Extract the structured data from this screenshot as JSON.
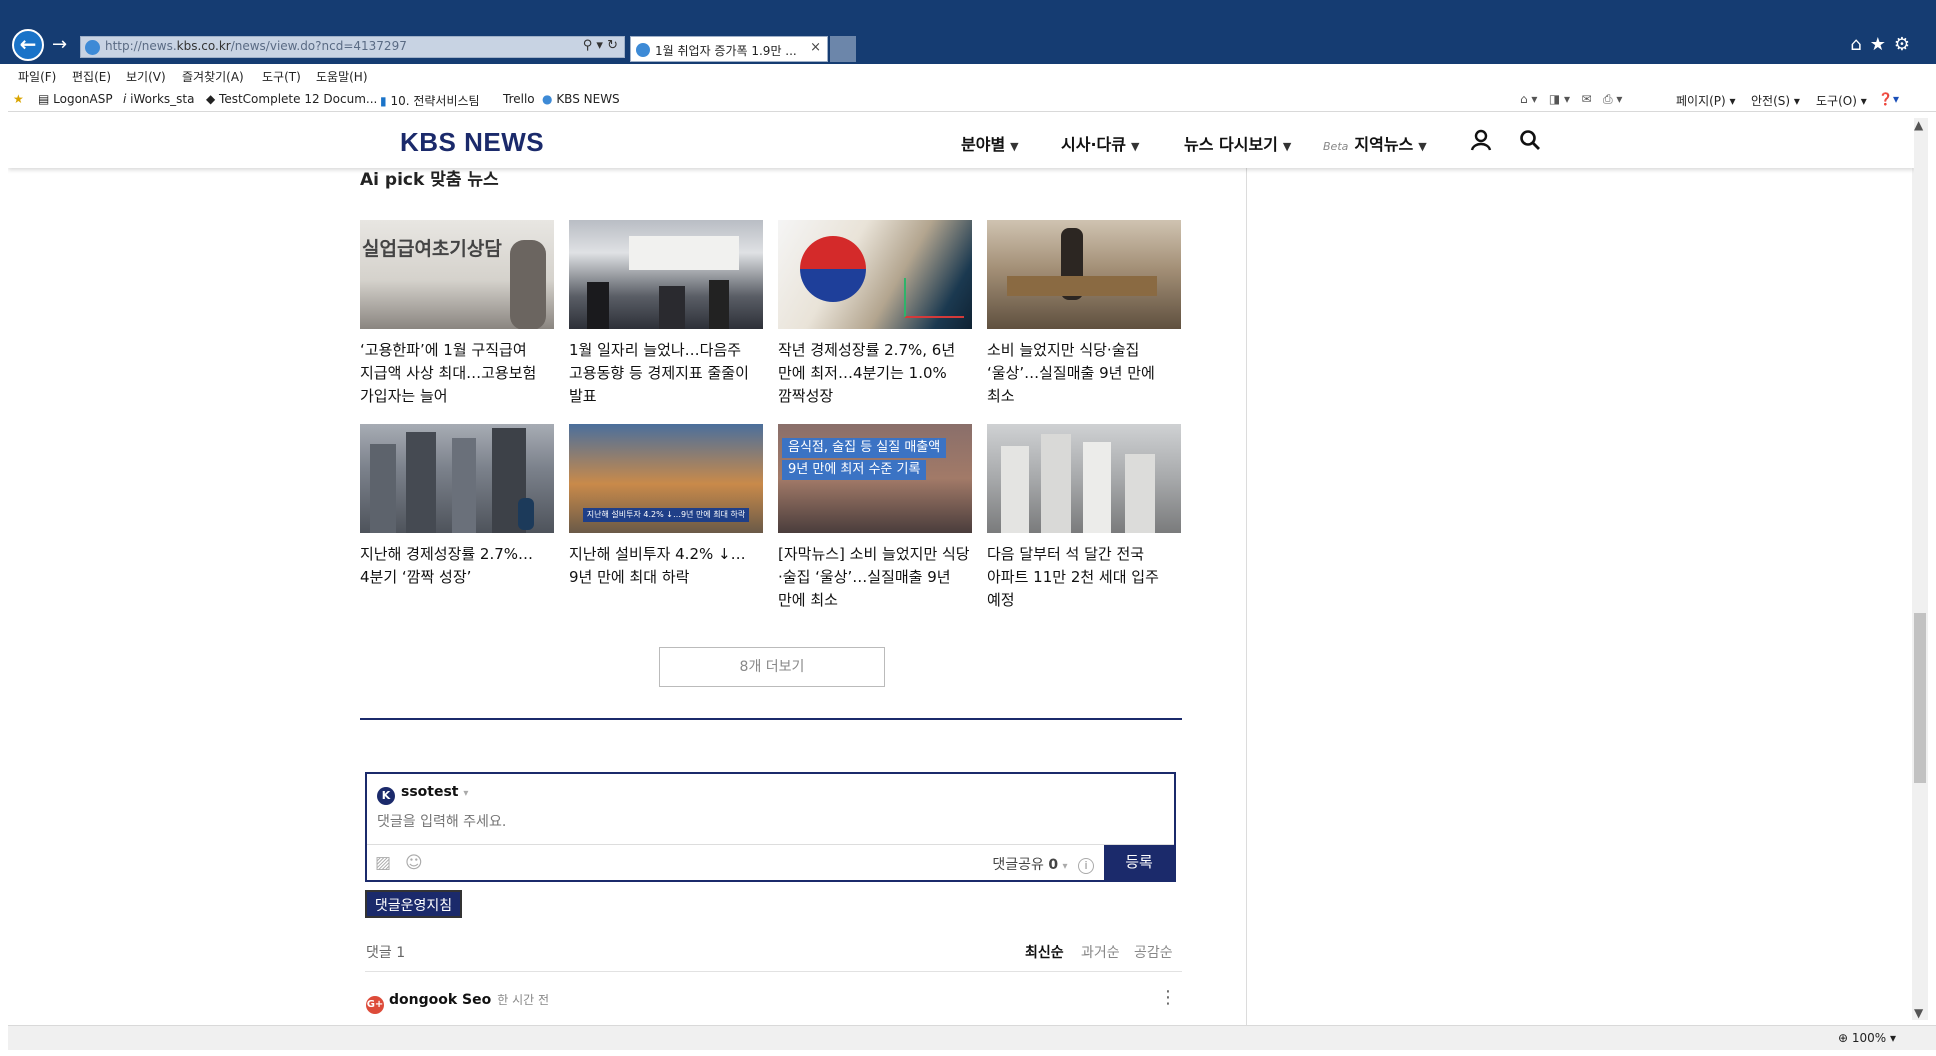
{
  "browser": {
    "url_prefix": "http://news.",
    "url_domain": "kbs.co.kr",
    "url_path": "/news/view.do?ncd=4137297",
    "tab_title": "1월 취업자 증가폭 1.9만 ...",
    "address_icons": "⚲ ▾ ↻",
    "menu": [
      "파일(F)",
      "편집(E)",
      "보기(V)",
      "즐겨찾기(A)",
      "도구(T)",
      "도움말(H)"
    ],
    "favorites": [
      "LogonASP",
      "iWorks_sta",
      "TestComplete 12 Docum...",
      "10. 전략서비스팀",
      "Trello",
      "KBS NEWS"
    ],
    "commandbar": [
      "페이지(P) ▾",
      "안전(S) ▾",
      "도구(O) ▾"
    ],
    "zoom": "100%"
  },
  "site": {
    "logo": "KBS NEWS",
    "nav": [
      {
        "label": "분야별",
        "beta": ""
      },
      {
        "label": "시사·다큐",
        "beta": ""
      },
      {
        "label": "뉴스 다시보기",
        "beta": ""
      },
      {
        "label": "지역뉴스",
        "beta": "Beta"
      }
    ]
  },
  "section": {
    "title": "Ai pick 맞춤 뉴스",
    "articles": [
      {
        "title": "‘고용한파’에 1월 구직급여 지급액 사상 최대…고용보험 가입자는 늘어",
        "thumb": "실업급여초기상담"
      },
      {
        "title": "1월 일자리 늘었나…다음주 고용동향 등 경제지표 줄줄이 발표",
        "thumb": ""
      },
      {
        "title": "작년 경제성장률 2.7%, 6년 만에 최저…4분기는 1.0% 깜짝성장",
        "thumb": ""
      },
      {
        "title": "소비 늘었지만 식당·술집 ‘울상’…실질매출 9년 만에 최소",
        "thumb": ""
      },
      {
        "title": "지난해 경제성장률 2.7%…4분기 ‘깜짝 성장’",
        "thumb": ""
      },
      {
        "title": "지난해 설비투자 4.2% ↓…9년 만에 최대 하락",
        "thumb": "지난해 설비투자 4.2% ↓…9년 만에 최대 하락"
      },
      {
        "title": "[자막뉴스] 소비 늘었지만 식당·술집 ‘울상’…실질매출 9년 만에 최소",
        "thumb": "음식점, 술집 등 실질 매출액",
        "thumb2": "9년 만에 최저 수준 기록"
      },
      {
        "title": "다음 달부터 석 달간 전국 아파트 11만 2천 세대 입주 예정",
        "thumb": ""
      }
    ],
    "more_label": "8개 더보기"
  },
  "comments": {
    "username": "ssotest",
    "placeholder": "댓글을 입력해 주세요.",
    "share_label": "댓글공유",
    "share_count": "0",
    "submit_label": "등록",
    "policy_label": "댓글운영지침",
    "count_label": "댓글 1",
    "sort": [
      "최신순",
      "과거순",
      "공감순"
    ],
    "first_author": "dongook Seo",
    "first_time": "한 시간 전"
  },
  "colors": {
    "brand": "#1b2a6b",
    "chrome": "#153c72"
  }
}
